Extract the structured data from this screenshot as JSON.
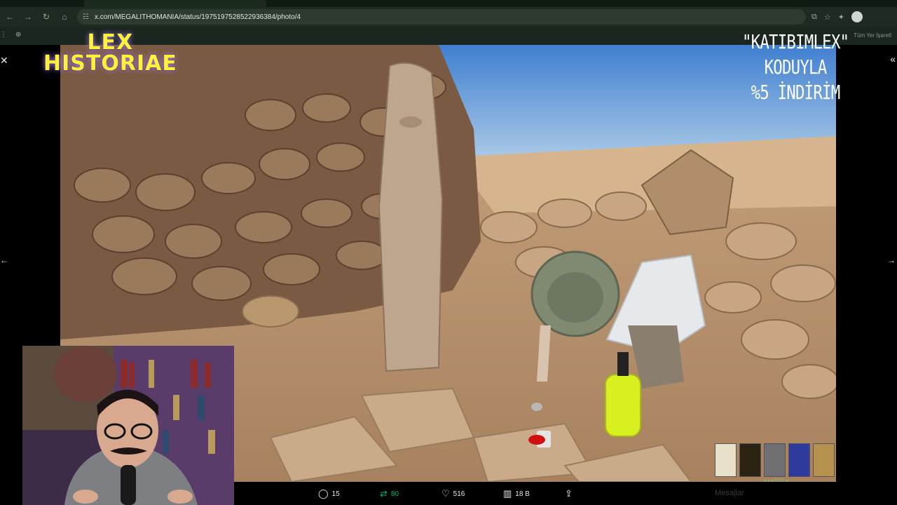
{
  "browser": {
    "url": "x.com/MEGALITHOMANIA/status/1975197528522936384/photo/4",
    "bookmark_right": "Tüm Yer İşaretl"
  },
  "overlay": {
    "logo_line1": "LEX",
    "logo_line2": "HISTORIAE",
    "promo_line1": "\"KATIBIMLEX\" KODUYLA",
    "promo_line2": "%5 İNDİRİM"
  },
  "post_actions": {
    "replies": "15",
    "reposts": "80",
    "likes": "516",
    "views": "18 B"
  },
  "books": {
    "caption": "● ● ● KICK ●"
  },
  "side": {
    "label": "Mesajlar"
  },
  "colors": {
    "repost_green": "#00ba7c",
    "logo_yellow": "#fff03a"
  }
}
